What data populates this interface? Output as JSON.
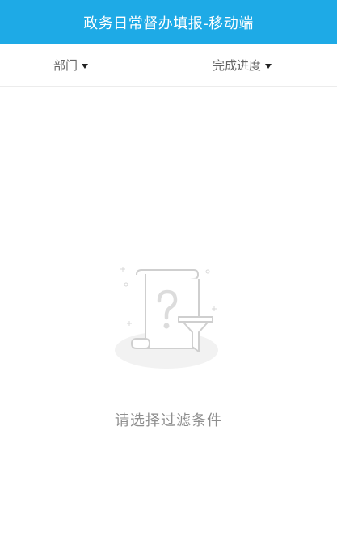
{
  "header": {
    "title": "政务日常督办填报-移动端"
  },
  "filters": {
    "department_label": "部门",
    "progress_label": "完成进度"
  },
  "empty_state": {
    "icon": "empty-filter-icon",
    "message": "请选择过滤条件"
  },
  "colors": {
    "header_bg": "#1eaae6",
    "header_text": "#ffffff",
    "filter_text": "#666666",
    "empty_text": "#8e8e8e"
  }
}
